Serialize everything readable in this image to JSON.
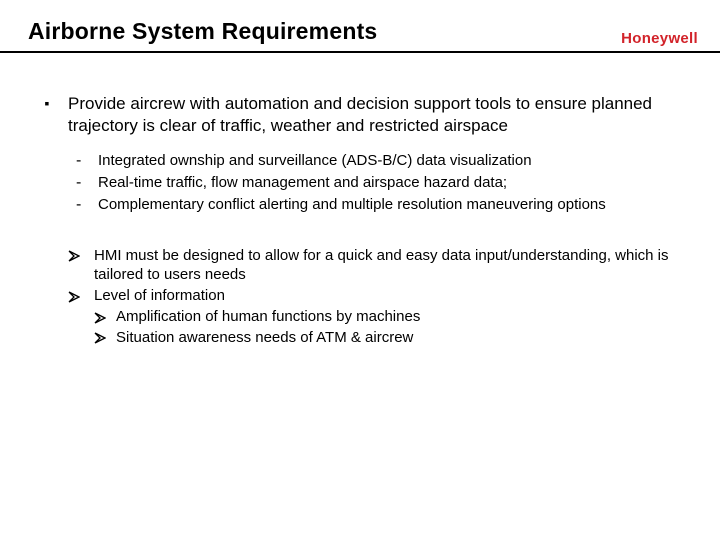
{
  "header": {
    "title": "Airborne System Requirements",
    "logo": "Honeywell"
  },
  "main": {
    "bullet1": "Provide aircrew with automation and decision support tools to ensure planned trajectory is clear of traffic, weather and restricted airspace",
    "sub": [
      "Integrated ownship and surveillance (ADS-B/C) data visualization",
      "Real-time traffic, flow management and airspace hazard data;",
      "Complementary conflict alerting and multiple resolution maneuvering options"
    ],
    "q1": "HMI must be designed to allow for a quick and easy data input/understanding, which is tailored to users needs",
    "q2": "Level of information",
    "q2_sub": [
      "Amplification of human functions by machines",
      "Situation awareness needs of ATM & aircrew"
    ]
  }
}
